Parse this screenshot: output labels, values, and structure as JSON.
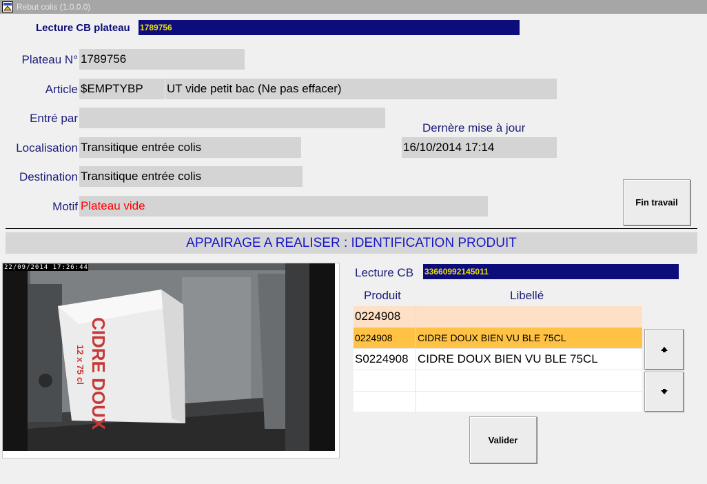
{
  "window": {
    "title": "Rebut colis (1.0.0.0)",
    "icon": "app-icon"
  },
  "scan": {
    "label": "Lecture CB plateau",
    "value": "1789756"
  },
  "form": {
    "plateau_label": "Plateau N°",
    "plateau_value": "1789756",
    "article_label": "Article",
    "article_code": "$EMPTYBP",
    "article_desc": "UT vide petit bac (Ne pas effacer)",
    "entre_par_label": "Entré par",
    "entre_par_value": "",
    "derniere_maj_label": "Dernère mise à jour",
    "derniere_maj_value": "16/10/2014 17:14",
    "localisation_label": "Localisation",
    "localisation_value": "Transitique entrée colis",
    "destination_label": "Destination",
    "destination_value": "Transitique entrée colis",
    "motif_label": "Motif",
    "motif_value": "Plateau vide",
    "motif_color": "#ff0000"
  },
  "buttons": {
    "fin_travail": "Fin travail",
    "valider": "Valider",
    "up_icon": "arrow-up-icon",
    "down_icon": "arrow-down-icon"
  },
  "banner": {
    "text": "APPAIRAGE A REALISER : IDENTIFICATION PRODUIT"
  },
  "camera": {
    "timestamp": "22/09/2014 17:26:44",
    "box_text_main": "CIDRE DOUX",
    "box_text_sub": "12 x 75 cl"
  },
  "product_scan": {
    "label": "Lecture CB",
    "value": "33660992145011"
  },
  "table": {
    "headers": [
      "Produit",
      "Libellé"
    ],
    "rows": [
      {
        "produit": "0224908",
        "libelle": "",
        "style": "search",
        "bg": "#fde0c6"
      },
      {
        "produit": "0224908",
        "libelle": "CIDRE DOUX BIEN VU BLE 75CL",
        "style": "selected",
        "bg": "#ffc244"
      },
      {
        "produit": "S0224908",
        "libelle": "CIDRE DOUX BIEN VU BLE 75CL",
        "style": "normal",
        "bg": "#ffffff"
      },
      {
        "produit": "",
        "libelle": "",
        "style": "empty",
        "bg": "#ffffff"
      },
      {
        "produit": "",
        "libelle": "",
        "style": "empty",
        "bg": "#ffffff"
      }
    ]
  }
}
